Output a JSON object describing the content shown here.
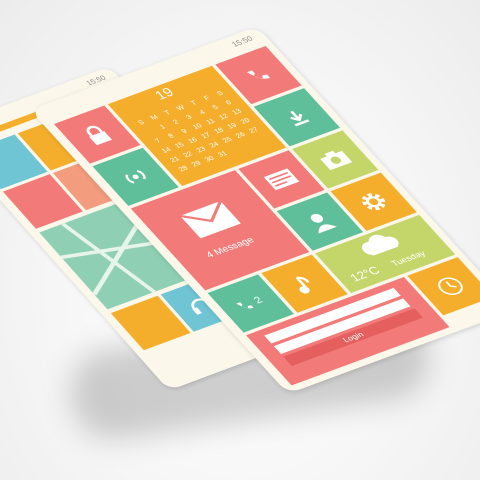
{
  "status": {
    "time_back": "15:50",
    "time_front": "15:50"
  },
  "calendar": {
    "day": "19",
    "weekdays": [
      "S",
      "M",
      "T",
      "W",
      "T",
      "F",
      "S"
    ],
    "dates": [
      [
        "",
        "1",
        "2",
        "3",
        "4",
        "5",
        "6"
      ],
      [
        "7",
        "8",
        "9",
        "10",
        "11",
        "12",
        "13"
      ],
      [
        "14",
        "15",
        "16",
        "17",
        "18",
        "19",
        "20"
      ],
      [
        "21",
        "22",
        "23",
        "24",
        "25",
        "26",
        "27"
      ],
      [
        "28",
        "29",
        "30",
        "31",
        "",
        "",
        ""
      ]
    ]
  },
  "message": {
    "label": "4 Message"
  },
  "weather": {
    "temp": "12°C",
    "day": "Tuesday"
  },
  "phone_tile": {
    "count": "2"
  },
  "login": {
    "button": "Login"
  },
  "icons": {
    "lock": "lock-icon",
    "phone_small": "phone-icon",
    "id_card": "id-card-icon",
    "camera": "camera-icon",
    "gear": "gear-icon",
    "user": "user-icon",
    "cloud": "cloud-icon",
    "music": "music-note-icon",
    "clock": "clock-icon",
    "headphones": "headphones-icon",
    "download": "download-icon",
    "signal": "signal-icon"
  },
  "colors": {
    "pink": "#f27a78",
    "orange": "#f5ae2c",
    "green": "#5fbf9a",
    "lime": "#c4d66a",
    "blue": "#6fc5d4",
    "cream": "#fbf7ea"
  }
}
